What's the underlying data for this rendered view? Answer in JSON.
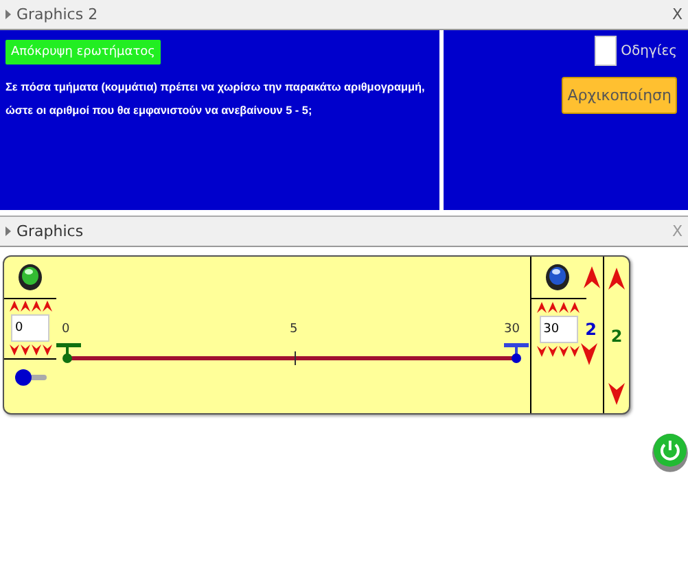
{
  "top_panel": {
    "title": "Graphics 2",
    "close": "X",
    "hide_button": "Απόκρυψη ερωτήματος",
    "question": [
      "Σε πόσα τμήματα (κομμάτια) πρέπει να χωρίσω την παρακάτω αριθμογραμμή,",
      "ώστε οι αριθμοί που θα εμφανιστούν να ανεβαίνουν 5 - 5;"
    ],
    "instructions": {
      "label": "Οδηγίες",
      "checked": false
    },
    "reset_button": "Αρχικοποίηση"
  },
  "graphics": {
    "title": "Graphics",
    "close": "X",
    "start": {
      "value": "0",
      "label": "0"
    },
    "middle_label": "5",
    "end": {
      "value": "30",
      "label": "30"
    },
    "segments": "2",
    "answer": "2"
  }
}
